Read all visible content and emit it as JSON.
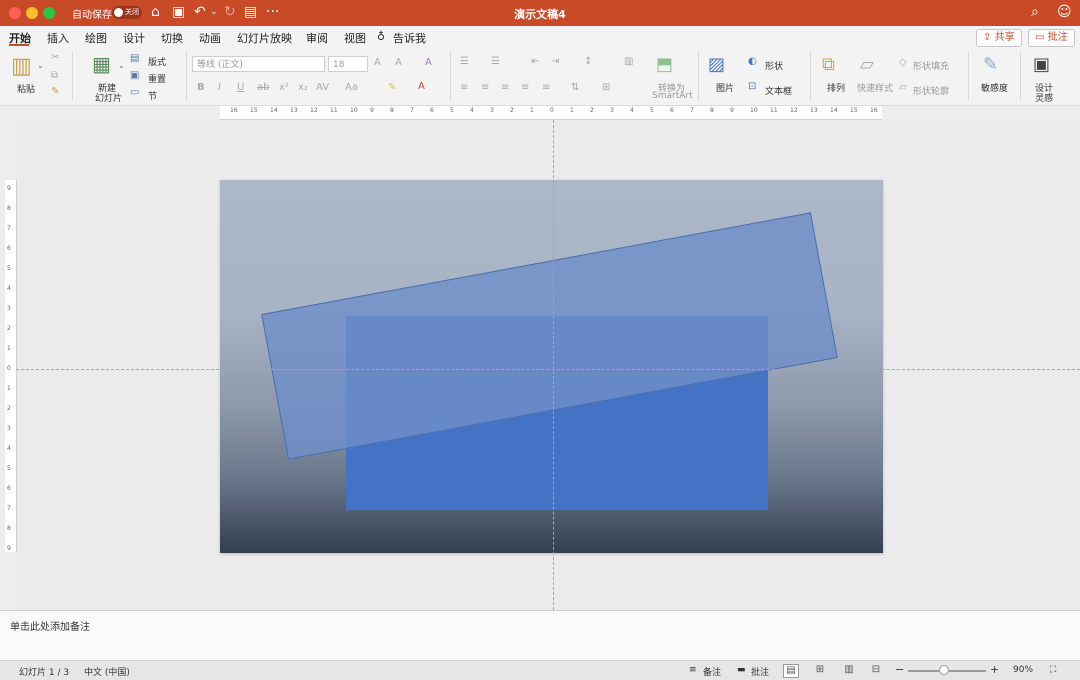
{
  "window": {
    "title": "演示文稿4",
    "autosave_label": "自动保存",
    "autosave_state": "关闭"
  },
  "tabs": [
    "开始",
    "插入",
    "绘图",
    "设计",
    "切换",
    "动画",
    "幻灯片放映",
    "审阅",
    "视图"
  ],
  "tell_me": "告诉我",
  "header_buttons": {
    "share": "共享",
    "comment": "批注"
  },
  "ribbon": {
    "paste": "粘贴",
    "new_slide_1": "新建",
    "new_slide_2": "幻灯片",
    "layout": "版式",
    "reset": "重置",
    "section": "节",
    "font_name": "等线 (正文)",
    "font_size": "18",
    "convert_smartart_1": "转换为",
    "convert_smartart_2": "SmartArt",
    "picture": "图片",
    "shape": "形状",
    "textbox": "文本框",
    "arrange": "排列",
    "quick_styles": "快速样式",
    "shape_fill": "形状填充",
    "shape_outline": "形状轮廓",
    "sensitivity": "敏感度",
    "designer_1": "设计",
    "designer_2": "灵感"
  },
  "ruler": {
    "h_ticks": [
      "16",
      "15",
      "14",
      "13",
      "12",
      "11",
      "10",
      "9",
      "8",
      "7",
      "6",
      "5",
      "4",
      "3",
      "2",
      "1",
      "0",
      "1",
      "2",
      "3",
      "4",
      "5",
      "6",
      "7",
      "8",
      "9",
      "10",
      "11",
      "12",
      "13",
      "14",
      "15",
      "16"
    ],
    "v_ticks": [
      "9",
      "8",
      "7",
      "6",
      "5",
      "4",
      "3",
      "2",
      "1",
      "0",
      "1",
      "2",
      "3",
      "4",
      "5",
      "6",
      "7",
      "8",
      "9"
    ]
  },
  "notes": {
    "placeholder": "单击此处添加备注"
  },
  "status": {
    "slide": "幻灯片 1 / 3",
    "language": "中文 (中国)",
    "notes": "备注",
    "comments": "批注",
    "zoom": "90%"
  },
  "colors": {
    "titlebar": "#c84a27",
    "shape_front": "#4472c4",
    "shape_rotated": "#6f8fc9"
  }
}
